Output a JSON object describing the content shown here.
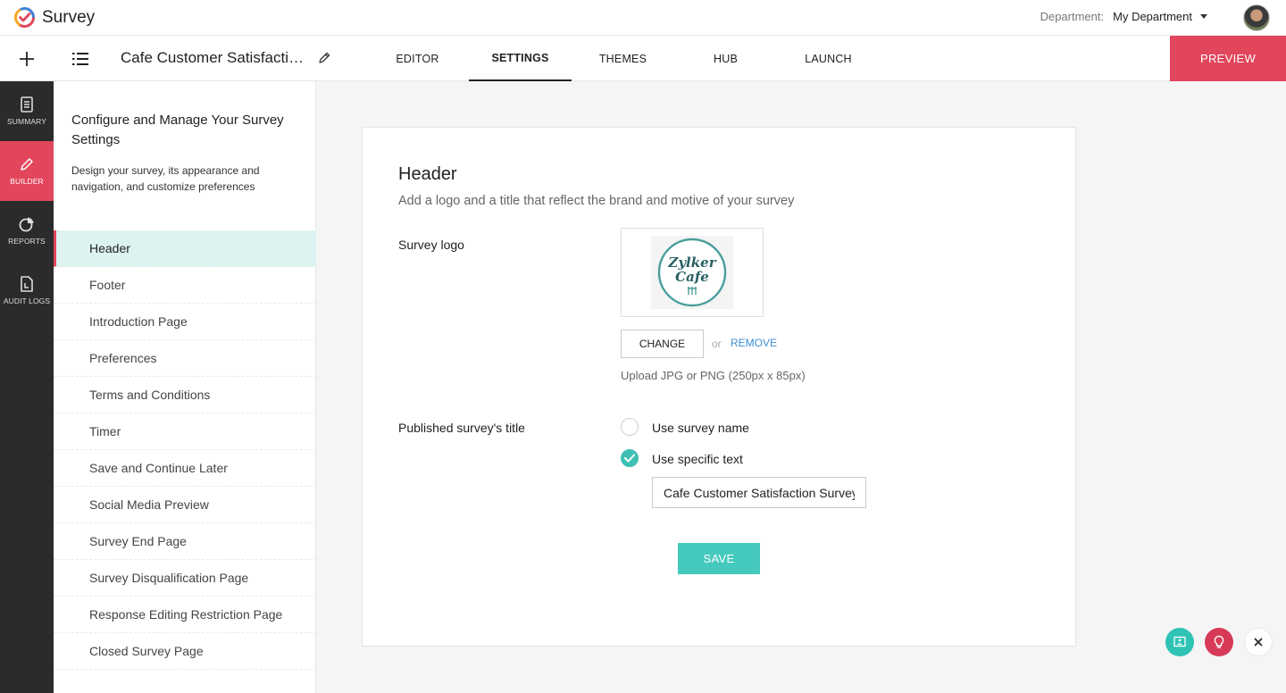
{
  "app": {
    "name": "Survey"
  },
  "header": {
    "department_label": "Department:",
    "department_value": "My Department"
  },
  "toolbar": {
    "survey_name": "Cafe Customer Satisfacti…",
    "tabs": [
      "EDITOR",
      "SETTINGS",
      "THEMES",
      "HUB",
      "LAUNCH"
    ],
    "active_tab": "SETTINGS",
    "preview_label": "PREVIEW",
    "accent_color": "#e2465c"
  },
  "rail": {
    "items": [
      {
        "label": "SUMMARY",
        "icon": "document-icon"
      },
      {
        "label": "BUILDER",
        "icon": "pencil-icon"
      },
      {
        "label": "REPORTS",
        "icon": "pie-chart-icon"
      },
      {
        "label": "AUDIT LOGS",
        "icon": "log-file-icon"
      }
    ],
    "active": "BUILDER"
  },
  "panel": {
    "title": "Configure and Manage Your Survey Settings",
    "description": "Design your survey, its appearance and navigation, and customize preferences",
    "items": [
      "Header",
      "Footer",
      "Introduction Page",
      "Preferences",
      "Terms and Conditions",
      "Timer",
      "Save and Continue Later",
      "Social Media Preview",
      "Survey End Page",
      "Survey Disqualification Page",
      "Response Editing Restriction Page",
      "Closed Survey Page"
    ],
    "active": "Header"
  },
  "main": {
    "title": "Header",
    "subtitle": "Add a logo and a title that reflect the brand and motive of your survey",
    "logo_label": "Survey logo",
    "logo_text_line1": "Zylker",
    "logo_text_line2": "Cafe",
    "change_label": "CHANGE",
    "or_text": "or",
    "remove_label": "REMOVE",
    "upload_hint": "Upload JPG or PNG (250px x 85px)",
    "title_label": "Published survey's title",
    "option_survey_name": "Use survey name",
    "option_specific_text": "Use specific text",
    "selected_option": "Use specific text",
    "title_value": "Cafe Customer Satisfaction Survey",
    "save_label": "SAVE",
    "save_color": "#45c9bc"
  }
}
